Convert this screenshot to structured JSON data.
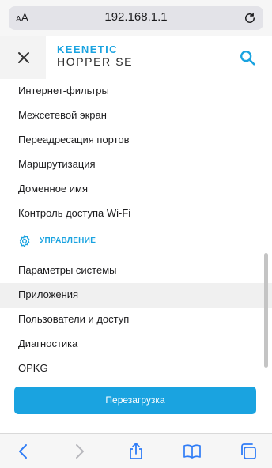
{
  "browser": {
    "text_size_label": "AA",
    "url": "192.168.1.1"
  },
  "header": {
    "logo_line1": "KEENETIC",
    "logo_line2": "HOPPER SE"
  },
  "menu": {
    "items_top": [
      "Интернет-фильтры",
      "Межсетевой экран",
      "Переадресация портов",
      "Маршрутизация",
      "Доменное имя",
      "Контроль доступа Wi-Fi"
    ],
    "section_title": "УПРАВЛЕНИЕ",
    "items_bottom": [
      "Параметры системы",
      "Приложения",
      "Пользователи и доступ",
      "Диагностика",
      "OPKG"
    ],
    "active_item": "Приложения"
  },
  "reboot_label": "Перезагрузка",
  "colors": {
    "accent": "#1aa3e0",
    "ios_blue": "#2f7cf6"
  }
}
